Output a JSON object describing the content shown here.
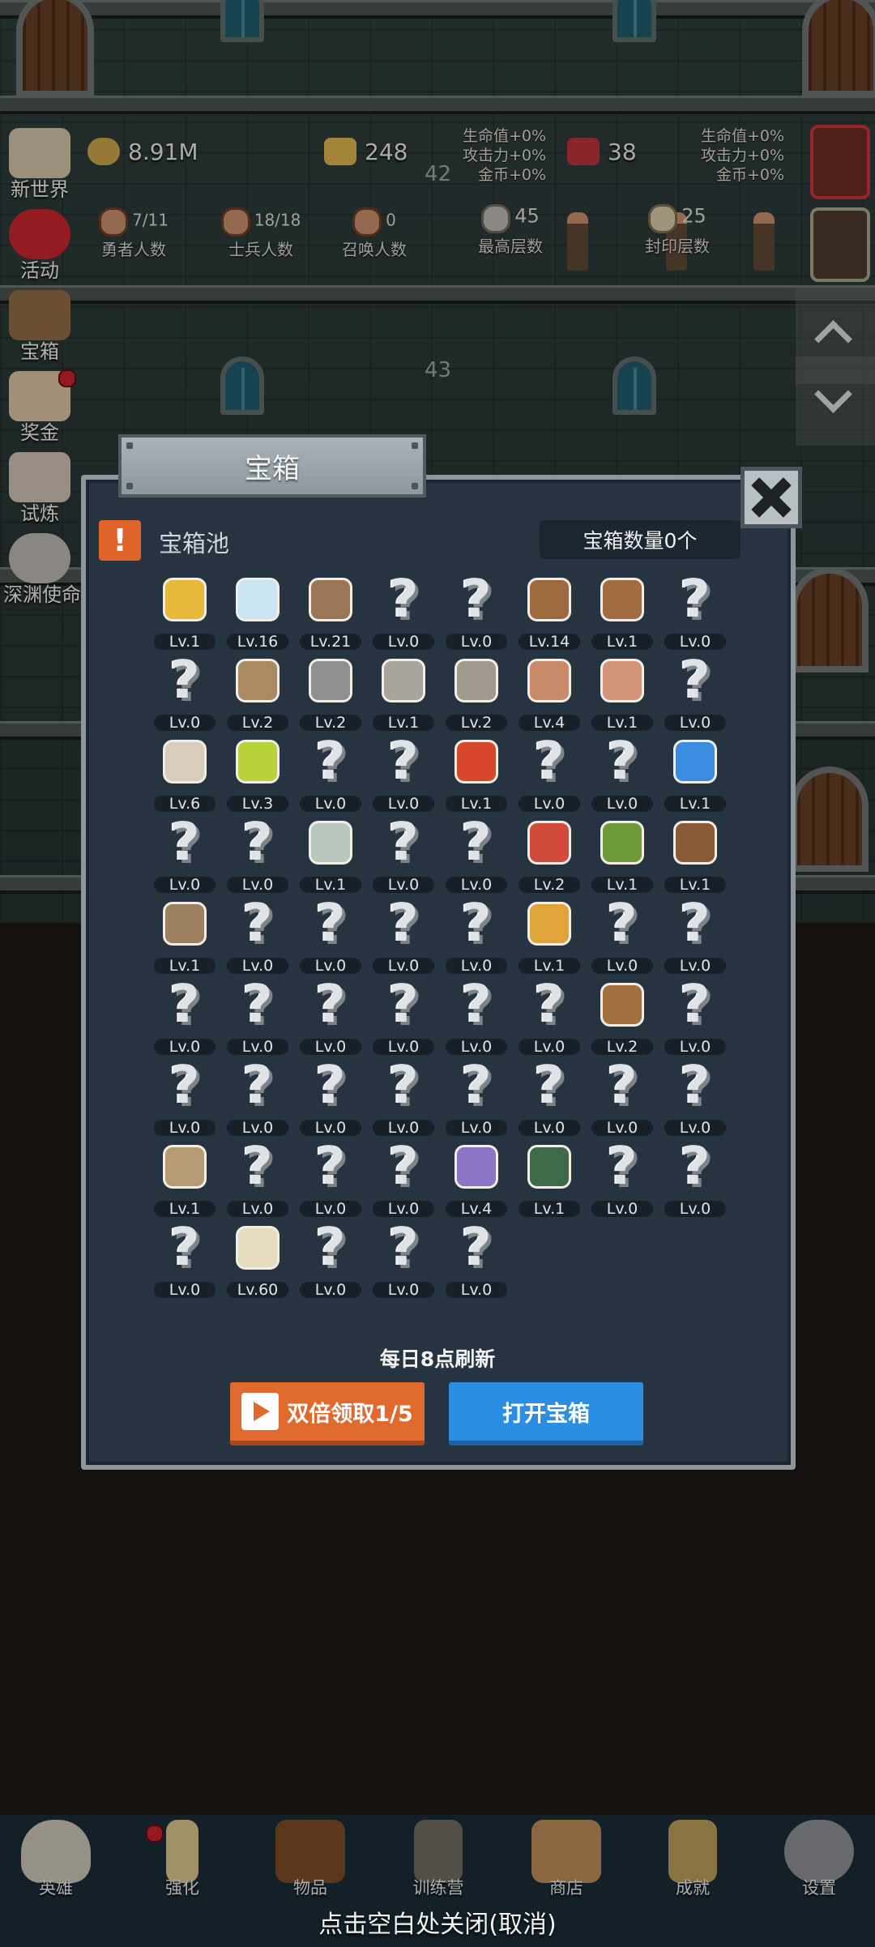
{
  "hud": {
    "side_menu": [
      {
        "label": "新世界"
      },
      {
        "label": "活动"
      },
      {
        "label": "宝箱"
      },
      {
        "label": "奖金"
      },
      {
        "label": "试炼"
      },
      {
        "label": "深渊使命"
      }
    ],
    "resources": {
      "gold": "8.91M",
      "bars": "248",
      "gems": "38"
    },
    "buff_left": [
      "生命值+0%",
      "攻击力+0%",
      "金币+0%"
    ],
    "buff_right": [
      "生命值+0%",
      "攻击力+0%",
      "金币+0%"
    ],
    "counts": [
      {
        "value": "7/11",
        "label": "勇者人数"
      },
      {
        "value": "18/18",
        "label": "士兵人数"
      },
      {
        "value": "0",
        "label": "召唤人数"
      },
      {
        "value": "45",
        "label": "最高层数"
      },
      {
        "value": "25",
        "label": "封印层数"
      }
    ],
    "floor_numbers": [
      "42",
      "43"
    ]
  },
  "dialog": {
    "title": "宝箱",
    "pool_title": "宝箱池",
    "chest_count": "宝箱数量0个",
    "refresh_note": "每日8点刷新",
    "btn_double": "双倍领取1/5",
    "btn_open": "打开宝箱",
    "items": [
      {
        "icon": "crown",
        "lv": "Lv.1"
      },
      {
        "icon": "diamond",
        "lv": "Lv.16"
      },
      {
        "icon": "sword",
        "lv": "Lv.21"
      },
      {
        "icon": "unknown",
        "lv": "Lv.0"
      },
      {
        "icon": "unknown",
        "lv": "Lv.0"
      },
      {
        "icon": "leather-armor",
        "lv": "Lv.14"
      },
      {
        "icon": "backpack",
        "lv": "Lv.1"
      },
      {
        "icon": "unknown",
        "lv": "Lv.0"
      },
      {
        "icon": "unknown",
        "lv": "Lv.0"
      },
      {
        "icon": "dagger",
        "lv": "Lv.2"
      },
      {
        "icon": "helmet",
        "lv": "Lv.2"
      },
      {
        "icon": "hammer",
        "lv": "Lv.1"
      },
      {
        "icon": "great-helm",
        "lv": "Lv.2"
      },
      {
        "icon": "ham",
        "lv": "Lv.4"
      },
      {
        "icon": "steak",
        "lv": "Lv.1"
      },
      {
        "icon": "unknown",
        "lv": "Lv.0"
      },
      {
        "icon": "flour-sack",
        "lv": "Lv.6"
      },
      {
        "icon": "yellow-potion",
        "lv": "Lv.3"
      },
      {
        "icon": "unknown",
        "lv": "Lv.0"
      },
      {
        "icon": "unknown",
        "lv": "Lv.0"
      },
      {
        "icon": "red-potion",
        "lv": "Lv.1"
      },
      {
        "icon": "unknown",
        "lv": "Lv.0"
      },
      {
        "icon": "unknown",
        "lv": "Lv.0"
      },
      {
        "icon": "blue-potion",
        "lv": "Lv.1"
      },
      {
        "icon": "unknown",
        "lv": "Lv.0"
      },
      {
        "icon": "unknown",
        "lv": "Lv.0"
      },
      {
        "icon": "empty-bottle",
        "lv": "Lv.1"
      },
      {
        "icon": "unknown",
        "lv": "Lv.0"
      },
      {
        "icon": "unknown",
        "lv": "Lv.0"
      },
      {
        "icon": "red-vial",
        "lv": "Lv.2"
      },
      {
        "icon": "winged-boots",
        "lv": "Lv.1"
      },
      {
        "icon": "boot",
        "lv": "Lv.1"
      },
      {
        "icon": "shoe",
        "lv": "Lv.1"
      },
      {
        "icon": "unknown",
        "lv": "Lv.0"
      },
      {
        "icon": "unknown",
        "lv": "Lv.0"
      },
      {
        "icon": "unknown",
        "lv": "Lv.0"
      },
      {
        "icon": "unknown",
        "lv": "Lv.0"
      },
      {
        "icon": "torch",
        "lv": "Lv.1"
      },
      {
        "icon": "unknown",
        "lv": "Lv.0"
      },
      {
        "icon": "unknown",
        "lv": "Lv.0"
      },
      {
        "icon": "unknown",
        "lv": "Lv.0"
      },
      {
        "icon": "unknown",
        "lv": "Lv.0"
      },
      {
        "icon": "unknown",
        "lv": "Lv.0"
      },
      {
        "icon": "unknown",
        "lv": "Lv.0"
      },
      {
        "icon": "unknown",
        "lv": "Lv.0"
      },
      {
        "icon": "unknown",
        "lv": "Lv.0"
      },
      {
        "icon": "leather-bag",
        "lv": "Lv.2"
      },
      {
        "icon": "unknown",
        "lv": "Lv.0"
      },
      {
        "icon": "unknown",
        "lv": "Lv.0"
      },
      {
        "icon": "unknown",
        "lv": "Lv.0"
      },
      {
        "icon": "unknown",
        "lv": "Lv.0"
      },
      {
        "icon": "unknown",
        "lv": "Lv.0"
      },
      {
        "icon": "unknown",
        "lv": "Lv.0"
      },
      {
        "icon": "unknown",
        "lv": "Lv.0"
      },
      {
        "icon": "unknown",
        "lv": "Lv.0"
      },
      {
        "icon": "unknown",
        "lv": "Lv.0"
      },
      {
        "icon": "bow",
        "lv": "Lv.1"
      },
      {
        "icon": "unknown",
        "lv": "Lv.0"
      },
      {
        "icon": "unknown",
        "lv": "Lv.0"
      },
      {
        "icon": "unknown",
        "lv": "Lv.0"
      },
      {
        "icon": "tentacle-monster",
        "lv": "Lv.4"
      },
      {
        "icon": "emblem",
        "lv": "Lv.1"
      },
      {
        "icon": "unknown",
        "lv": "Lv.0"
      },
      {
        "icon": "unknown",
        "lv": "Lv.0"
      },
      {
        "icon": "unknown",
        "lv": "Lv.0"
      },
      {
        "icon": "beer-mug",
        "lv": "Lv.60"
      },
      {
        "icon": "unknown",
        "lv": "Lv.0"
      },
      {
        "icon": "unknown",
        "lv": "Lv.0"
      },
      {
        "icon": "unknown",
        "lv": "Lv.0"
      }
    ]
  },
  "nav": {
    "items": [
      {
        "label": "英雄",
        "icon": "skull-icon"
      },
      {
        "label": "强化",
        "icon": "candle-icon"
      },
      {
        "label": "物品",
        "icon": "book-icon"
      },
      {
        "label": "训练营",
        "icon": "lantern-icon"
      },
      {
        "label": "商店",
        "icon": "beer-mug-icon"
      },
      {
        "label": "成就",
        "icon": "key-icon"
      },
      {
        "label": "设置",
        "icon": "gear-icon"
      }
    ],
    "close_hint": "点击空白处关闭(取消)"
  },
  "colors": {
    "dialog_bg": "#263341",
    "accent_orange": "#e06a2d",
    "accent_blue": "#2b8ee3",
    "nav_bg": "#1a2b36"
  }
}
